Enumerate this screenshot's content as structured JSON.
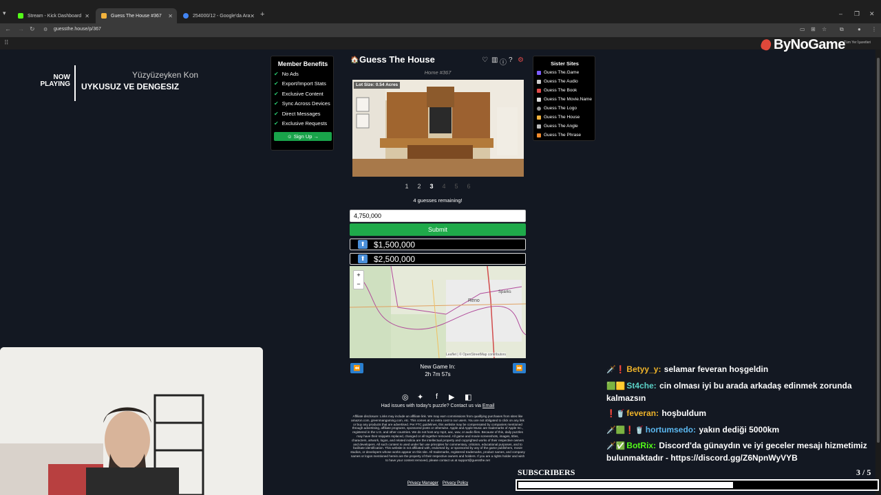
{
  "browser": {
    "tabs": [
      {
        "label": "Stream - Kick Dashboard",
        "color": "#53fc18"
      },
      {
        "label": "Guess The House #367",
        "color": "#f3b33d"
      },
      {
        "label": "254000/12 - Google'da Ara",
        "color": "#4285f4"
      }
    ],
    "url": "guessthe.house/p/367",
    "bookmark_right": "Tüm Yer İşaretleri"
  },
  "now_playing": {
    "label_line1": "NOW",
    "label_line2": "PLAYING",
    "artist": "Yüzyüzeyken Kon",
    "title": "UYKUSUZ VE DENGESIZ"
  },
  "benefits": {
    "title": "Member Benefits",
    "items": [
      "No Ads",
      "Export/Import Stats",
      "Exclusive Content",
      "Sync Across Devices",
      "Direct Messages",
      "Exclusive Requests"
    ],
    "signup": "Sign Up →"
  },
  "game": {
    "title": "Guess The House",
    "subtitle": "Home #367",
    "lot_size": "Lot Size: 0.54 Acres",
    "pages": [
      "1",
      "2",
      "3",
      "4",
      "5",
      "6"
    ],
    "active_page": "3",
    "guesses_remaining": "4 guesses remaining!",
    "input_value": "4,750,000",
    "submit": "Submit",
    "previous_guesses": [
      {
        "value": "$1,500,000",
        "direction": "up"
      },
      {
        "value": "$2,500,000",
        "direction": "up"
      }
    ],
    "map": {
      "labels": [
        "Reno",
        "Sparks"
      ],
      "zoom_in": "+",
      "zoom_out": "−",
      "attribution": "Leaflet | © OpenStreetMap contributors"
    },
    "new_game_label": "New Game In:",
    "new_game_time": "2h 7m 57s",
    "issues_text": "Had issues with today's puzzle? Contact us via ",
    "issues_link": "Email",
    "disclaimer": "Affiliate disclosure: Links may include an affiliate link. We may earn commissions from qualifying purchases from sites like amazon.com, greenmangaming.com, etc. This comes at no extra cost to our users. You are not obligated to click on any link or buy any products that are advertised. Per FTC guidelines, this website may be compensated by companies mentioned through advertising, affiliate programs, sponsored posts or otherwise. Apple and Apple Music are trademarks of Apple Inc., registered in the U.S. and other countries. We do not host any mp3, aac, wav, or audio files. Because of this, daily puzzles may have their snippets replaced, changed or all together removed. All game and movie screenshots, images, titles, characters, artwork, logos, and related indicia are the intellectual property and copyrighted works of their respective owners and developers. All such content is used under fair use principles for commentary, criticism, educational purposes, and to facilitate identification. This website is not affiliated with, endorsed by, or sponsored by any of the game publishers, movie studios, or developers whose works appear on this site. All trademarks, registered trademarks, product names, and company names or logos mentioned herein are the property of their respective owners and holders. If you are a rights holder and wish to have your content removed, please contact us at support@guessthe.net",
    "footer": [
      "Privacy Manager",
      "Privacy Policy"
    ]
  },
  "sister": {
    "title": "Sister Sites",
    "sites": [
      {
        "label": "Guess The.Game",
        "color": "#7b5cff"
      },
      {
        "label": "Guess The Audio",
        "color": "#cccccc"
      },
      {
        "label": "Guess The Book",
        "color": "#e04a4a"
      },
      {
        "label": "Guess The Movie.Name",
        "color": "#dddddd"
      },
      {
        "label": "Guess The Logo",
        "color": "#999999"
      },
      {
        "label": "Guess The House",
        "color": "#f3b33d"
      },
      {
        "label": "Guess The Angle",
        "color": "#bbbbbb"
      },
      {
        "label": "Guess The Phrase",
        "color": "#f28b2c"
      }
    ]
  },
  "brand": "ByNoGame",
  "chat": [
    {
      "icon": "🗡️❗",
      "user": "Betyy_y:",
      "color": "#f0b429",
      "text": "selamar feveran hoşgeldin"
    },
    {
      "icon": "🟩🟨",
      "user": "St4che:",
      "color": "#5bd2c8",
      "text": "cin olması iyi bu arada arkadaş edinmek zorunda kalmazsın"
    },
    {
      "icon": "❗🥤",
      "user": "feveran:",
      "color": "#f0b429",
      "text": "hoşbuldum"
    },
    {
      "icon": "🗡️🟩❗🥤",
      "user": "hortumsedo:",
      "color": "#5bb8f0",
      "text": "yakın dediği 5000km"
    },
    {
      "icon": "🗡️✅",
      "user": "BotRix:",
      "color": "#53fc18",
      "text": "Discord'da günaydın ve iyi geceler mesajı hizmetimiz bulunmaktadır - https://discord.gg/Z6NpnWyVYB"
    }
  ],
  "subscribers": {
    "label": "SUBSCRIBERS",
    "count": "3 / 5",
    "progress": 0.6
  }
}
